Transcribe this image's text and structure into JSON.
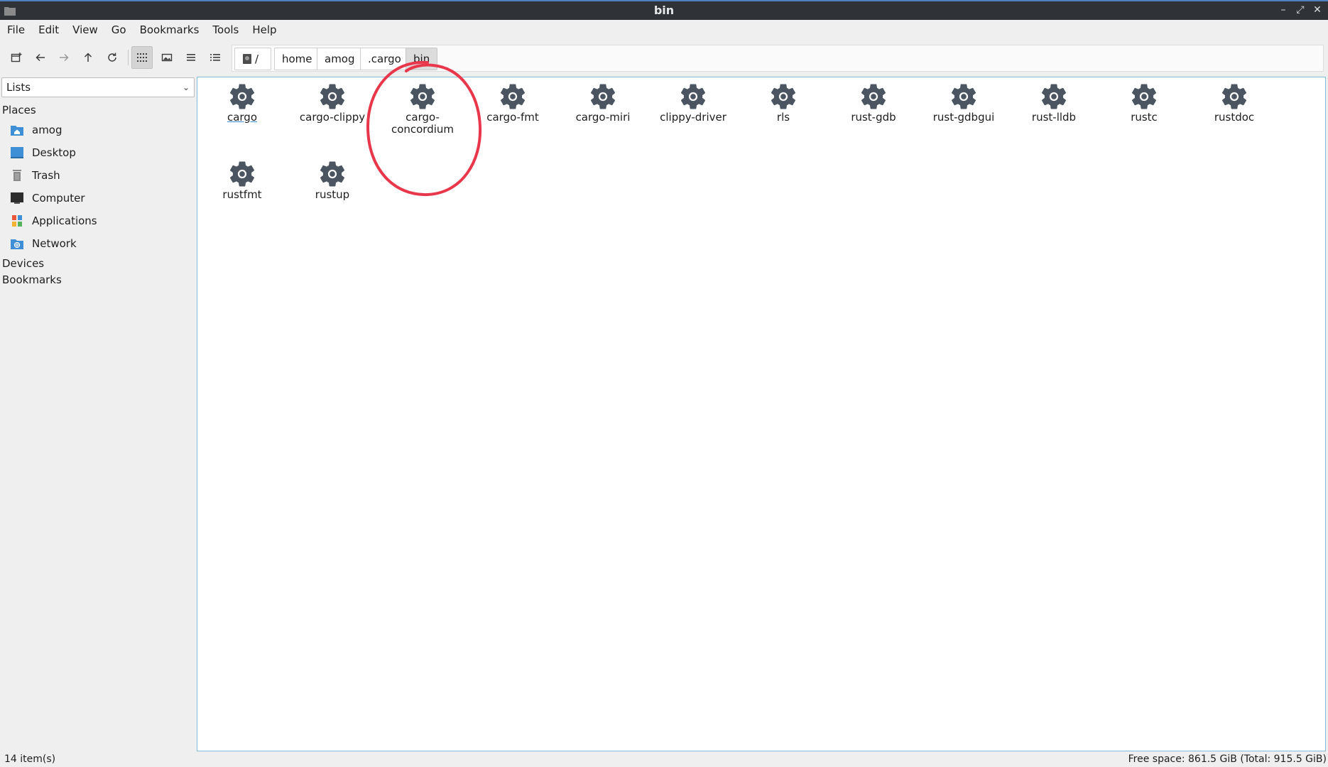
{
  "window": {
    "title": "bin",
    "controls": [
      "minimize-icon",
      "maximize-icon",
      "close-icon"
    ]
  },
  "menubar": {
    "items": [
      "File",
      "Edit",
      "View",
      "Go",
      "Bookmarks",
      "Tools",
      "Help"
    ]
  },
  "toolbar": {
    "buttons": [
      "new-tab-icon",
      "back-icon",
      "forward-icon",
      "up-icon",
      "reload-icon",
      "icon-view-icon",
      "thumbnail-view-icon",
      "compact-view-icon",
      "detailed-list-icon"
    ],
    "active_view": "icon-view"
  },
  "pathbar": {
    "crumbs": [
      "/",
      "home",
      "amog",
      ".cargo",
      "bin"
    ],
    "current": "bin"
  },
  "sidebar": {
    "lists_select": "Lists",
    "places_header": "Places",
    "places": [
      {
        "label": "amog",
        "icon": "home-folder-icon"
      },
      {
        "label": "Desktop",
        "icon": "desktop-icon"
      },
      {
        "label": "Trash",
        "icon": "trash-icon"
      },
      {
        "label": "Computer",
        "icon": "computer-icon"
      },
      {
        "label": "Applications",
        "icon": "applications-icon"
      },
      {
        "label": "Network",
        "icon": "network-icon"
      }
    ],
    "devices_header": "Devices",
    "bookmarks_header": "Bookmarks"
  },
  "files": [
    {
      "name": "cargo",
      "icon": "gear-icon"
    },
    {
      "name": "cargo-clippy",
      "icon": "gear-icon"
    },
    {
      "name": "cargo-\nconcordium",
      "icon": "gear-icon"
    },
    {
      "name": "cargo-fmt",
      "icon": "gear-icon"
    },
    {
      "name": "cargo-miri",
      "icon": "gear-icon"
    },
    {
      "name": "clippy-driver",
      "icon": "gear-icon"
    },
    {
      "name": "rls",
      "icon": "gear-icon"
    },
    {
      "name": "rust-gdb",
      "icon": "gear-icon"
    },
    {
      "name": "rust-gdbgui",
      "icon": "gear-icon"
    },
    {
      "name": "rust-lldb",
      "icon": "gear-icon"
    },
    {
      "name": "rustc",
      "icon": "gear-icon"
    },
    {
      "name": "rustdoc",
      "icon": "gear-icon"
    },
    {
      "name": "rustfmt",
      "icon": "gear-icon"
    },
    {
      "name": "rustup",
      "icon": "gear-icon"
    }
  ],
  "focused_file": "cargo",
  "annotation": {
    "shape": "hand-drawn circle",
    "color": "#e8374a",
    "target": "cargo-concordium"
  },
  "status": {
    "items": "14 item(s)",
    "free_space": "Free space: 861.5 GiB (Total: 915.5 GiB)"
  },
  "colors": {
    "titlebar": "#2f3338",
    "accent": "#4f7ec1",
    "gear": "#4a5561",
    "view_border": "#7fbfd9"
  }
}
